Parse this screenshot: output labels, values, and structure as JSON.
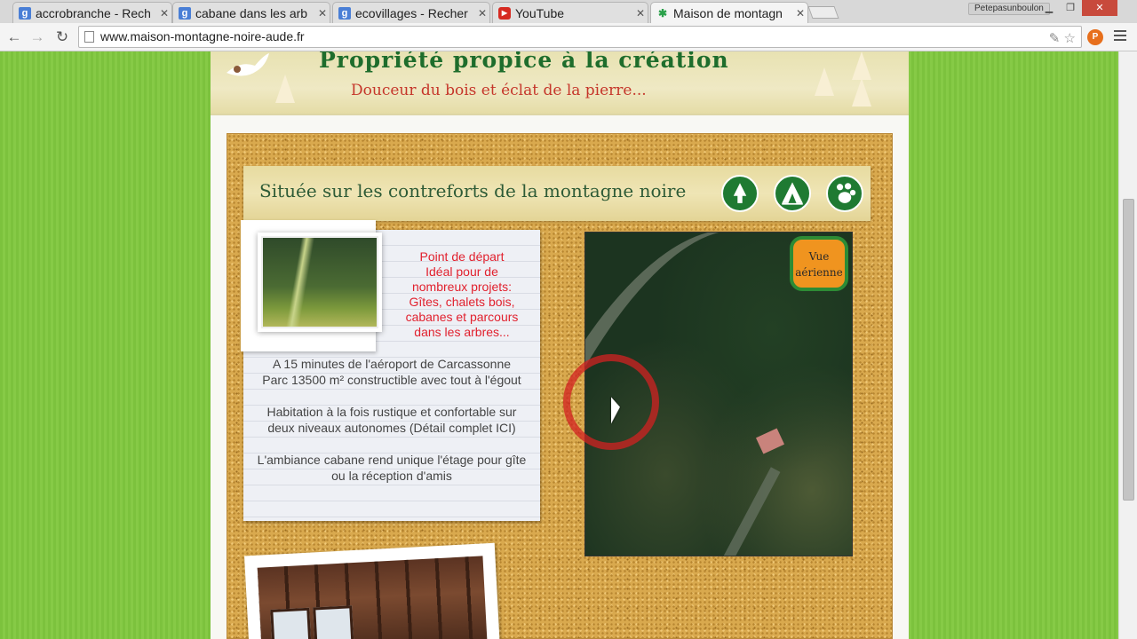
{
  "browser": {
    "tabs": [
      {
        "title": "accrobranche - Rech",
        "favicon": "google-icon"
      },
      {
        "title": "cabane dans les arb",
        "favicon": "google-icon"
      },
      {
        "title": "ecovillages - Recher",
        "favicon": "google-icon"
      },
      {
        "title": "YouTube",
        "favicon": "youtube-icon"
      },
      {
        "title": "Maison de montagn",
        "favicon": "site-icon"
      }
    ],
    "profile_name": "Petepasunboulon",
    "url": "www.maison-montagne-noire-aude.fr"
  },
  "site": {
    "banner_title": "Propriété propice à la création",
    "banner_subtitle": "Douceur du bois et éclat de la pierre...",
    "section_heading": "Située sur les contreforts de la montagne noire",
    "note_highlight": "Point de départ\nIdéal pour de\nnombreux projets:\nGîtes, chalets bois,\ncabanes et parcours\ndans les arbres...",
    "note_lines": [
      "A 15 minutes de l'aéroport de Carcassonne",
      "Parc 13500 m² constructible avec tout à l'égout",
      "Habitation  à la fois rustique et confortable sur",
      "deux niveaux autonomes  (Détail complet ICI)",
      "L'ambiance cabane rend unique l'étage pour gîte",
      "ou la réception d'amis"
    ],
    "aerial_badge": "Vue\naérienne"
  },
  "colors": {
    "banner_title": "#1e6d2c",
    "banner_subtitle": "#c5362a",
    "note_highlight": "#e1212e",
    "icon_green": "#1f7a32",
    "badge_orange": "#f0941f"
  }
}
